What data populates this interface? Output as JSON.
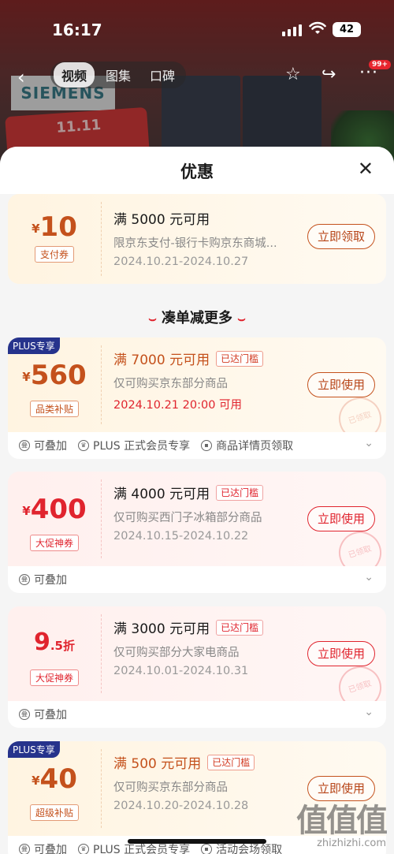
{
  "status_bar": {
    "time": "16:17",
    "battery": "42"
  },
  "background_page": {
    "nav_back": "‹",
    "tabs": [
      {
        "label": "视频",
        "active": true
      },
      {
        "label": "图集",
        "active": false
      },
      {
        "label": "口碑",
        "active": false
      }
    ],
    "more_badge": "99+",
    "brand_text": "SIEMENS",
    "promo_text": "11.11"
  },
  "sheet": {
    "title": "优惠",
    "close": "✕"
  },
  "section_title": "凑单减更多",
  "coupons": [
    {
      "currency": "¥",
      "amount": "10",
      "suffix": "",
      "tag": "支付券",
      "title": "满 5000 元可用",
      "reach": "",
      "desc": "限京东支付-银行卡购京东商城...",
      "date": "2024.10.21-2024.10.27",
      "button": "立即领取"
    },
    {
      "badge": "PLUS专享",
      "currency": "¥",
      "amount": "560",
      "suffix": "",
      "tag": "品类补贴",
      "title": "满 7000 元可用",
      "reach": "已达门槛",
      "desc": "仅可购买京东部分商品",
      "date": "2024.10.21 20:00 可用",
      "button": "立即使用",
      "stamp": "已领取",
      "foot": [
        "可叠加",
        "PLUS 正式会员专享",
        "商品详情页领取"
      ]
    },
    {
      "currency": "¥",
      "amount": "400",
      "suffix": "",
      "tag": "大促神券",
      "title": "满 4000 元可用",
      "reach": "已达门槛",
      "desc": "仅可购买西门子冰箱部分商品",
      "date": "2024.10.15-2024.10.22",
      "button": "立即使用",
      "stamp": "已领取",
      "foot": [
        "可叠加"
      ]
    },
    {
      "currency": "",
      "amount": "9",
      "suffix": ".5折",
      "tag": "大促神券",
      "title": "满 3000 元可用",
      "reach": "已达门槛",
      "desc": "仅可购买部分大家电商品",
      "date": "2024.10.01-2024.10.31",
      "button": "立即使用",
      "stamp": "已领取",
      "foot": [
        "可叠加"
      ]
    },
    {
      "badge": "PLUS专享",
      "currency": "¥",
      "amount": "40",
      "suffix": "",
      "tag": "超级补贴",
      "title": "满 500 元可用",
      "reach": "已达门槛",
      "desc": "仅可购买京东部分商品",
      "date": "2024.10.20-2024.10.28",
      "button": "立即使用",
      "foot": [
        "可叠加",
        "PLUS 正式会员专享",
        "活动会场领取"
      ]
    }
  ],
  "watermark": {
    "logo": "值值值",
    "url": "zhizhizhi.com"
  },
  "colors": {
    "accent_red": "#e0242e",
    "gold_text": "#c4511c",
    "plus_blue": "#26338c"
  }
}
